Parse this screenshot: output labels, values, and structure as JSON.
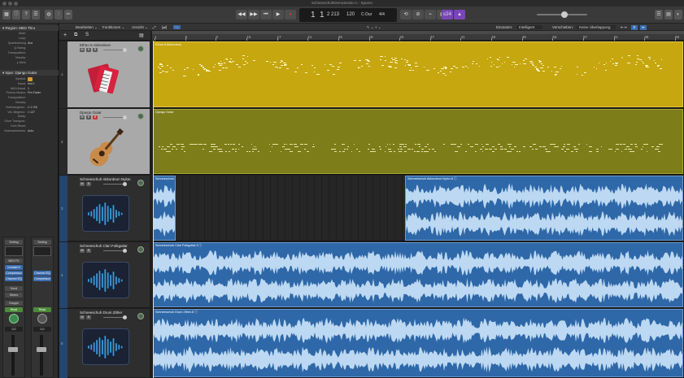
{
  "window": {
    "title": "SchneeschuhDemoSessio n - Spuren"
  },
  "control_bar": {
    "lcd": {
      "bar": "1",
      "beat": "1",
      "sub": "2 213",
      "tempo": "120",
      "key": "C-Dur",
      "signature": "4/4"
    },
    "count_in": "≤24"
  },
  "inspector": {
    "region_header": "▾ Region: MIDI Thru",
    "region_rows": [
      {
        "key": "Mute:",
        "value": ""
      },
      {
        "key": "Loop:",
        "value": ""
      },
      {
        "key": "Quantisierung",
        "value": "Aus"
      },
      {
        "key": "Q-Swing:",
        "value": ""
      },
      {
        "key": "Transposition:",
        "value": ""
      },
      {
        "key": "Velocity:",
        "value": ""
      },
      {
        "key": "▸ Mehr",
        "value": ""
      }
    ],
    "track_header": "▾ Spur: Django Gutar",
    "track_rows": [
      {
        "key": "Symbol:",
        "value": ""
      },
      {
        "key": "Kanal:",
        "value": "Inst 1"
      },
      {
        "key": "MIDI-Kanal:",
        "value": "1"
      },
      {
        "key": "Freeze-Modus:",
        "value": "Pre-Fader"
      },
      {
        "key": "Transposition:",
        "value": ""
      },
      {
        "key": "Velocity:",
        "value": ""
      },
      {
        "key": "Notenbegrenz.:",
        "value": "C-2  G8"
      },
      {
        "key": "Vel.-Begrenz.:",
        "value": "1  127"
      },
      {
        "key": "Delay:",
        "value": ""
      },
      {
        "key": "Ohne Transpos.:",
        "value": ""
      },
      {
        "key": "Kein Reset:",
        "value": ""
      },
      {
        "key": "Notenaufnahme:",
        "value": "Auto"
      }
    ],
    "strip1": {
      "setting": "Setting",
      "eq": "EQ",
      "midi_fx": "MIDI FX",
      "plugin1": "Kontakt 5",
      "plugin2": "Compressor",
      "plugin3": "Channel EQ",
      "send": "Send",
      "output": "Stereo",
      "group": "Gruppe",
      "automation": "Read",
      "level": "0,0",
      "name": "Django Gutar"
    },
    "strip2": {
      "setting": "Setting",
      "plugin1": "Channel EQ",
      "plugin2": "Compressor",
      "automation": "Read",
      "level": "0,0",
      "name": "Stereo Out"
    }
  },
  "tracks_menu": {
    "edit": "Bearbeiten ⌄",
    "functions": "Funktionen ⌄",
    "view": "Ansicht ⌄",
    "snap_label": "Einrasten:",
    "snap_value": "Intelligent",
    "drag_label": "Verschieben:",
    "drag_value": "Keine Überlappung"
  },
  "ruler": [
    "1",
    "5",
    "9",
    "13",
    "17",
    "21",
    "25",
    "29",
    "33",
    "37",
    "41",
    "45",
    "49",
    "53",
    "57",
    "61",
    "65",
    "69"
  ],
  "tracks": [
    {
      "num": "1",
      "name": "Ethno 6 Akkordeon",
      "region": "Ethno 6 Akkordeon",
      "color": "#c6a710"
    },
    {
      "num": "2",
      "name": "Django Gutar",
      "region": "Django Gutar",
      "color": "#7d7d19"
    },
    {
      "num": "3",
      "name": "Schneeschuh Akkordeon Nylon",
      "region": "Schneeschuh ...",
      "region2": "Schneeschuh Akkordeon Nylon.8 ⓘ",
      "color": "#2f68a8"
    },
    {
      "num": "4",
      "name": "Schneeschuh Clari Folkguitar",
      "region": "Schneeschuh Clari Folkguitar.3 ⓘ",
      "color": "#2f68a8"
    },
    {
      "num": "5",
      "name": "Schneeschuh Drum Zither",
      "region": "Schneeschuh Drum Zither.8 ⓘ",
      "color": "#2f68a8"
    }
  ]
}
